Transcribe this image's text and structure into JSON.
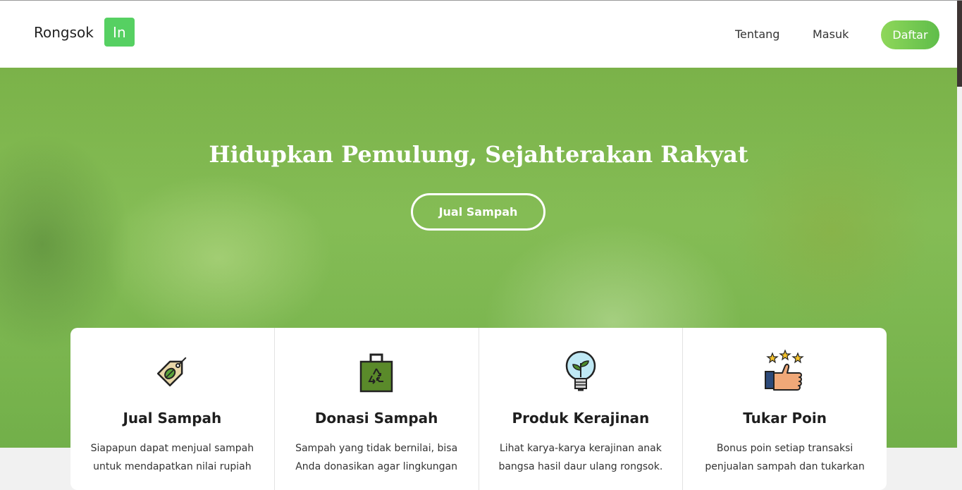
{
  "nav": {
    "brand_text": "Rongsok",
    "brand_badge": "In",
    "links": [
      "Tentang",
      "Masuk"
    ],
    "register_label": "Daftar"
  },
  "hero": {
    "title": "Hidupkan Pemulung, Sejahterakan Rakyat",
    "cta_label": "Jual Sampah"
  },
  "features": [
    {
      "icon": "price-tag-leaf-icon",
      "title": "Jual Sampah",
      "desc": "Siapapun dapat menjual sampah untuk mendapatkan nilai rupiah"
    },
    {
      "icon": "recycle-bag-icon",
      "title": "Donasi Sampah",
      "desc": "Sampah yang tidak bernilai, bisa Anda donasikan agar lingkungan"
    },
    {
      "icon": "plant-bulb-icon",
      "title": "Produk Kerajinan",
      "desc": "Lihat karya-karya kerajinan anak bangsa hasil daur ulang rongsok."
    },
    {
      "icon": "thumbs-up-stars-icon",
      "title": "Tukar Poin",
      "desc": "Bonus poin setiap transaksi penjualan sampah dan tukarkan"
    }
  ],
  "colors": {
    "brand_green": "#56d062",
    "register_gradient_start": "#8fd75a",
    "register_gradient_end": "#5fbd4a",
    "hero_overlay": "#7fb54a"
  }
}
